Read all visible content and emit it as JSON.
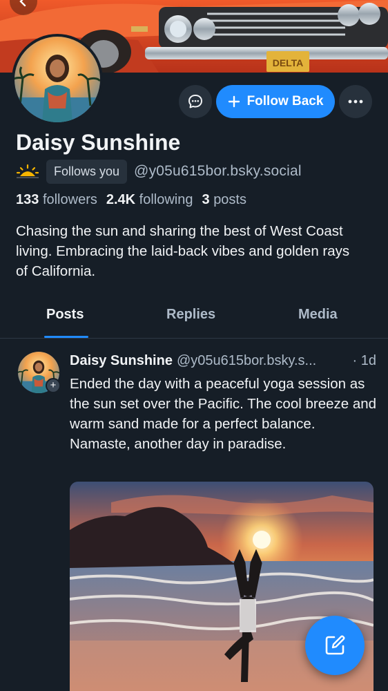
{
  "profile": {
    "display_name": "Daisy Sunshine",
    "follows_you_label": "Follows you",
    "handle": "@y05u615bor.bsky.social",
    "followers_count": "133",
    "followers_label": "followers",
    "following_count": "2.4K",
    "following_label": "following",
    "posts_count": "3",
    "posts_label": "posts",
    "bio": "Chasing the sun and sharing the best of West Coast living. Embracing the laid-back vibes and golden rays of California."
  },
  "actions": {
    "follow_label": "Follow Back"
  },
  "tabs": [
    {
      "label": "Posts",
      "active": true
    },
    {
      "label": "Replies",
      "active": false
    },
    {
      "label": "Media",
      "active": false
    }
  ],
  "post": {
    "author_name": "Daisy Sunshine",
    "author_handle": "@y05u615bor.bsky.s...",
    "time": "· 1d",
    "text": "Ended the day with a peaceful yoga session as the sun set over the Pacific. The cool breeze and warm sand made for a perfect balance. Namaste, another day in paradise."
  },
  "banner": {
    "plate_text": "DELTA"
  },
  "colors": {
    "background": "#161e27",
    "accent": "#208bfe",
    "secondary_text": "#aebbc9"
  },
  "icons": [
    "back-arrow-icon",
    "chat-bubble-icon",
    "plus-icon",
    "more-icon",
    "sun-icon",
    "compose-icon"
  ]
}
